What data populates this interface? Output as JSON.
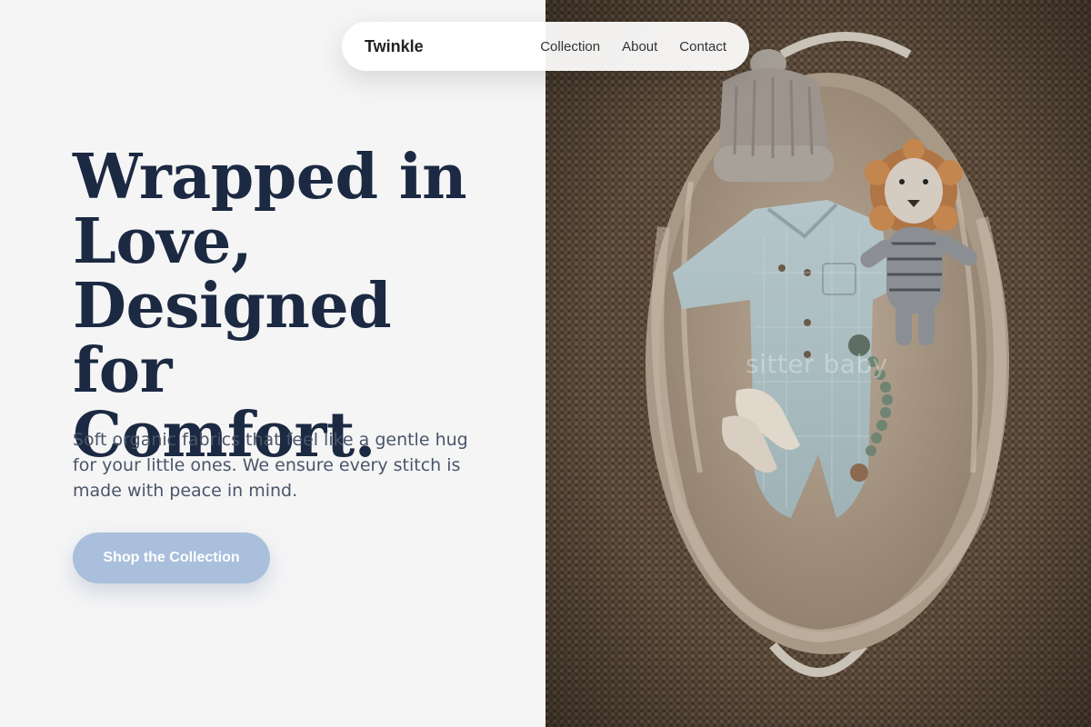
{
  "nav": {
    "brand": "Twinkle",
    "links": [
      "Collection",
      "About",
      "Contact"
    ]
  },
  "hero": {
    "headline_lines": [
      "Wrapped in",
      "Love,",
      "Designed for",
      "Comfort."
    ],
    "subtext": "Soft organic fabrics that feel like a gentle hug for your little ones. We ensure every stitch is made with peace in mind.",
    "cta_label": "Shop the Collection"
  },
  "photo": {
    "watermark": "sitter baby",
    "alt": "baby clothes flat lay on jute rug"
  },
  "colors": {
    "background": "#f5f5f6",
    "headline": "#1c2942",
    "subtext": "#4a5568",
    "cta": "#a9bfdc",
    "rug": "#5b4a3a"
  }
}
